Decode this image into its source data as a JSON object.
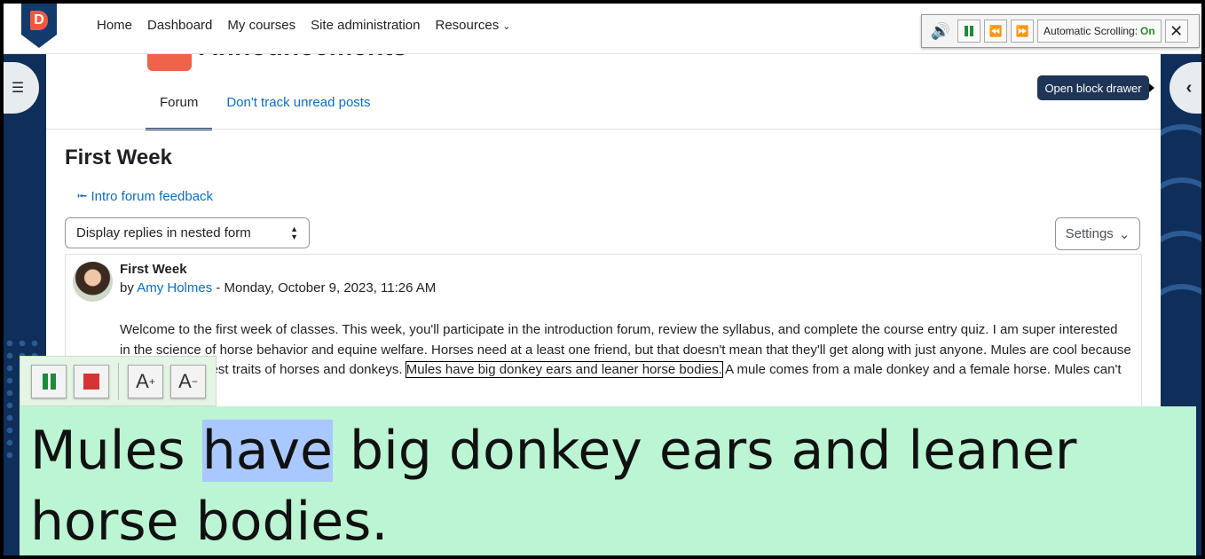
{
  "navbar": {
    "logo_letter": "D",
    "links": [
      "Home",
      "Dashboard",
      "My courses",
      "Site administration",
      "Resources"
    ]
  },
  "speech_toolbar": {
    "auto_scroll_label": "Automatic Scrolling:",
    "auto_scroll_state": "On"
  },
  "page": {
    "partial_title": "Announcements",
    "tabs": [
      "Forum",
      "Don't track unread posts"
    ],
    "heading": "First Week",
    "prev_link": "Intro forum feedback",
    "display_mode": "Display replies in nested form",
    "settings_label": "Settings",
    "tooltip": "Open block drawer"
  },
  "post": {
    "subject": "First Week",
    "by": "by",
    "author": "Amy Holmes",
    "date": " - Monday, October 9, 2023, 11:26 AM",
    "body_before": "Welcome to the first week of classes. This week, you'll participate in the introduction forum, review the syllabus, and complete the course entry quiz. I am super interested in the science of horse behavior and equine welfare. Horses need at a least one friend, but that doesn't mean that they'll get along with just anyone. Mules are cool because they have the best traits of horses and donkeys. ",
    "body_highlight": "Mules have big donkey ears and leaner horse bodies.",
    "body_after": " A mule comes from a male donkey and a female horse. Mules can't"
  },
  "reader": {
    "text_before": "Mules ",
    "current_word": "have",
    "text_after": " big donkey ears and leaner horse bodies.",
    "font_increase": "A",
    "font_decrease": "A"
  },
  "colors": {
    "reader_panel": "#bbf5d3",
    "word_highlight": "#a9c8ff",
    "link": "#0f6cbf",
    "sidebar": "#0f2f5a"
  }
}
